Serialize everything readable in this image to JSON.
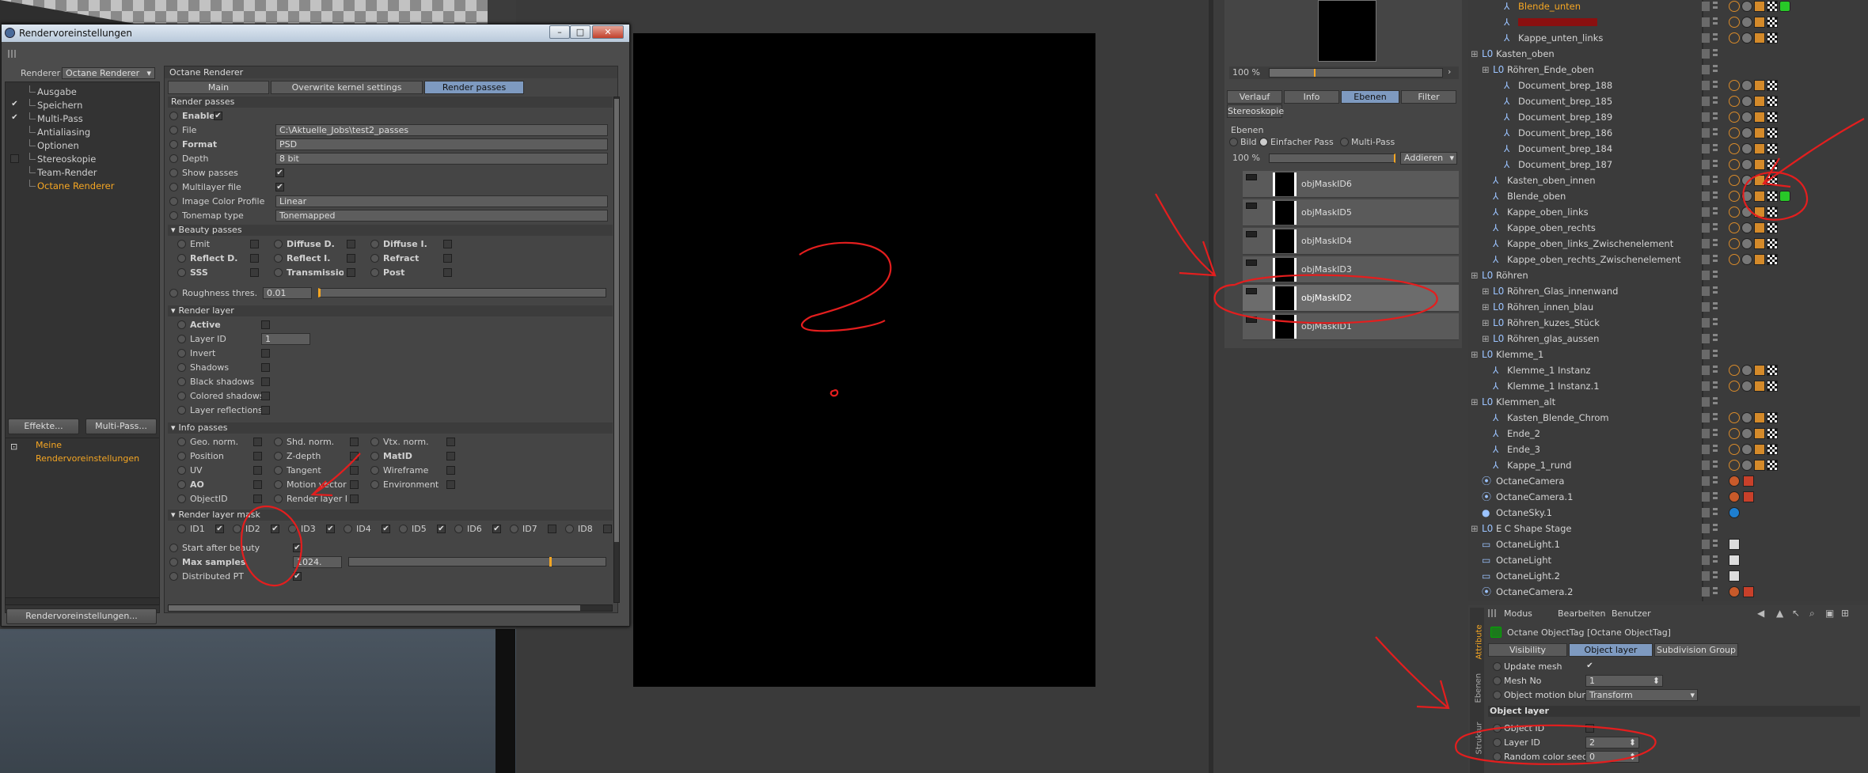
{
  "render_settings": {
    "title": "Rendervoreinstellungen",
    "renderer_label": "Renderer",
    "renderer_value": "Octane Renderer",
    "categories": [
      {
        "label": "Ausgabe",
        "checked": false
      },
      {
        "label": "Speichern",
        "checked": true
      },
      {
        "label": "Multi-Pass",
        "checked": true
      },
      {
        "label": "Antialiasing",
        "checked": false
      },
      {
        "label": "Optionen",
        "checked": false
      },
      {
        "label": "Stereoskopie",
        "checked": false
      },
      {
        "label": "Team-Render",
        "checked": false
      },
      {
        "label": "Octane Renderer",
        "checked": false,
        "active": true
      }
    ],
    "effects_button": "Effekte...",
    "multipass_button": "Multi-Pass...",
    "preset_label": "Meine Rendervoreinstellungen",
    "bottom_button": "Rendervoreinstellungen...",
    "panel_title": "Octane Renderer",
    "tabs": [
      "Main",
      "Overwrite kernel settings",
      "Render passes"
    ],
    "active_tab": "Render passes",
    "render_passes_header": "Render passes",
    "enable_label": "Enable",
    "file_label": "File",
    "file_value": "C:\\Aktuelle_Jobs\\test2_passes",
    "format_label": "Format",
    "format_value": "PSD",
    "depth_label": "Depth",
    "depth_value": "8 bit",
    "show_passes_label": "Show passes",
    "multilayer_label": "Multilayer file",
    "icp_label": "Image Color Profile",
    "icp_value": "Linear",
    "tonemap_label": "Tonemap type",
    "tonemap_value": "Tonemapped",
    "beauty_header": "Beauty passes",
    "beauty_passes": [
      "Emit",
      "Diffuse D.",
      "Diffuse I.",
      "Reflect D.",
      "Reflect I.",
      "Refract",
      "SSS",
      "Transmission",
      "Post"
    ],
    "roughness_label": "Roughness thres.",
    "roughness_value": "0.01",
    "render_layer_header": "Render layer",
    "render_layer_items": [
      "Active",
      "Layer ID",
      "Invert",
      "Shadows",
      "Black shadows",
      "Colored shadows",
      "Layer reflections"
    ],
    "layer_id_value": "1",
    "info_header": "Info passes",
    "info_passes": [
      "Geo. norm.",
      "Shd. norm.",
      "Vtx. norm.",
      "Position",
      "Z-depth",
      "MatID",
      "UV",
      "Tangent",
      "Wireframe",
      "AO",
      "Motion vector",
      "Environment",
      "ObjectID",
      "Render layer ID"
    ],
    "mask_header": "Render layer mask",
    "mask_ids": [
      {
        "label": "ID1",
        "checked": true
      },
      {
        "label": "ID2",
        "checked": true
      },
      {
        "label": "ID3",
        "checked": true
      },
      {
        "label": "ID4",
        "checked": true
      },
      {
        "label": "ID5",
        "checked": true
      },
      {
        "label": "ID6",
        "checked": true
      },
      {
        "label": "ID7",
        "checked": false
      },
      {
        "label": "ID8",
        "checked": false
      }
    ],
    "start_after_beauty": "Start after beauty",
    "max_samples_label": "Max samples",
    "max_samples_value": "1024.",
    "distributed_label": "Distributed PT"
  },
  "picture_viewer": {
    "zoom": "100 %",
    "tabs": [
      "Verlauf",
      "Info",
      "Ebenen",
      "Filter"
    ],
    "active_tab": "Ebenen",
    "stereo_tab": "Stereoskopie",
    "section": "Ebenen",
    "modes": [
      "Bild",
      "Einfacher Pass",
      "Multi-Pass"
    ],
    "layer_zoom": "100 %",
    "blend_mode": "Addieren",
    "layers": [
      "objMaskID6",
      "objMaskID5",
      "objMaskID4",
      "objMaskID3",
      "objMaskID2",
      "objMaskID1"
    ],
    "selected_layer": "objMaskID2"
  },
  "object_manager": {
    "rows": [
      {
        "name": "Blende_unten",
        "indent": 2,
        "highlight": true
      },
      {
        "name": "",
        "indent": 2,
        "redacted": true
      },
      {
        "name": "Kappe_unten_links",
        "indent": 2
      },
      {
        "name": "Kasten_oben",
        "indent": 0,
        "group": true
      },
      {
        "name": "Röhren_Ende_oben",
        "indent": 1,
        "group": true
      },
      {
        "name": "Document_brep_188",
        "indent": 2
      },
      {
        "name": "Document_brep_185",
        "indent": 2
      },
      {
        "name": "Document_brep_189",
        "indent": 2
      },
      {
        "name": "Document_brep_186",
        "indent": 2
      },
      {
        "name": "Document_brep_184",
        "indent": 2
      },
      {
        "name": "Document_brep_187",
        "indent": 2
      },
      {
        "name": "Kasten_oben_innen",
        "indent": 1
      },
      {
        "name": "Blende_oben",
        "indent": 1
      },
      {
        "name": "Kappe_oben_links",
        "indent": 1
      },
      {
        "name": "Kappe_oben_rechts",
        "indent": 1
      },
      {
        "name": "Kappe_oben_links_Zwischenelement",
        "indent": 1
      },
      {
        "name": "Kappe_oben_rechts_Zwischenelement",
        "indent": 1
      },
      {
        "name": "Röhren",
        "indent": 0,
        "group": true
      },
      {
        "name": "Röhren_Glas_innenwand",
        "indent": 1,
        "group": true
      },
      {
        "name": "Röhren_innen_blau",
        "indent": 1,
        "group": true
      },
      {
        "name": "Röhren_kuzes_Stück",
        "indent": 1,
        "group": true
      },
      {
        "name": "Röhren_glas_aussen",
        "indent": 1,
        "group": true
      },
      {
        "name": "Klemme_1",
        "indent": 0,
        "group": true
      },
      {
        "name": "Klemme_1 Instanz",
        "indent": 1
      },
      {
        "name": "Klemme_1 Instanz.1",
        "indent": 1
      },
      {
        "name": "Klemmen_alt",
        "indent": 0,
        "group": true
      },
      {
        "name": "Kasten_Blende_Chrom",
        "indent": 1
      },
      {
        "name": "Ende_2",
        "indent": 1
      },
      {
        "name": "Ende_3",
        "indent": 1
      },
      {
        "name": "Kappe_1_rund",
        "indent": 1
      },
      {
        "name": "OctaneCamera",
        "indent": 0
      },
      {
        "name": "OctaneCamera.1",
        "indent": 0
      },
      {
        "name": "OctaneSky.1",
        "indent": 0
      },
      {
        "name": "E C Shape Stage",
        "indent": 0,
        "group": true
      },
      {
        "name": "OctaneLight.1",
        "indent": 0
      },
      {
        "name": "OctaneLight",
        "indent": 0
      },
      {
        "name": "OctaneLight.2",
        "indent": 0
      },
      {
        "name": "OctaneCamera.2",
        "indent": 0
      }
    ]
  },
  "attributes": {
    "menu": [
      "Modus",
      "Bearbeiten",
      "Benutzer"
    ],
    "side_tabs": [
      "Attribute",
      "Ebenen",
      "Struktur"
    ],
    "title": "Octane ObjectTag [Octane ObjectTag]",
    "tabs": [
      "Visibility",
      "Object layer",
      "Subdivision Group"
    ],
    "active_tab": "Object layer",
    "update_mesh": "Update mesh",
    "mesh_no_label": "Mesh No",
    "mesh_no_value": "1",
    "motion_blur_label": "Object motion blur",
    "motion_blur_value": "Transform",
    "section": "Object layer",
    "object_id_label": "Object ID",
    "layer_id_label": "Layer ID",
    "layer_id_value": "2",
    "random_seed_label": "Random color seed",
    "random_seed_value": "0"
  },
  "colors": {
    "accent_blue": "#7e9ac0",
    "active_orange": "#f5a623",
    "annotation_red": "#e41e1e"
  }
}
